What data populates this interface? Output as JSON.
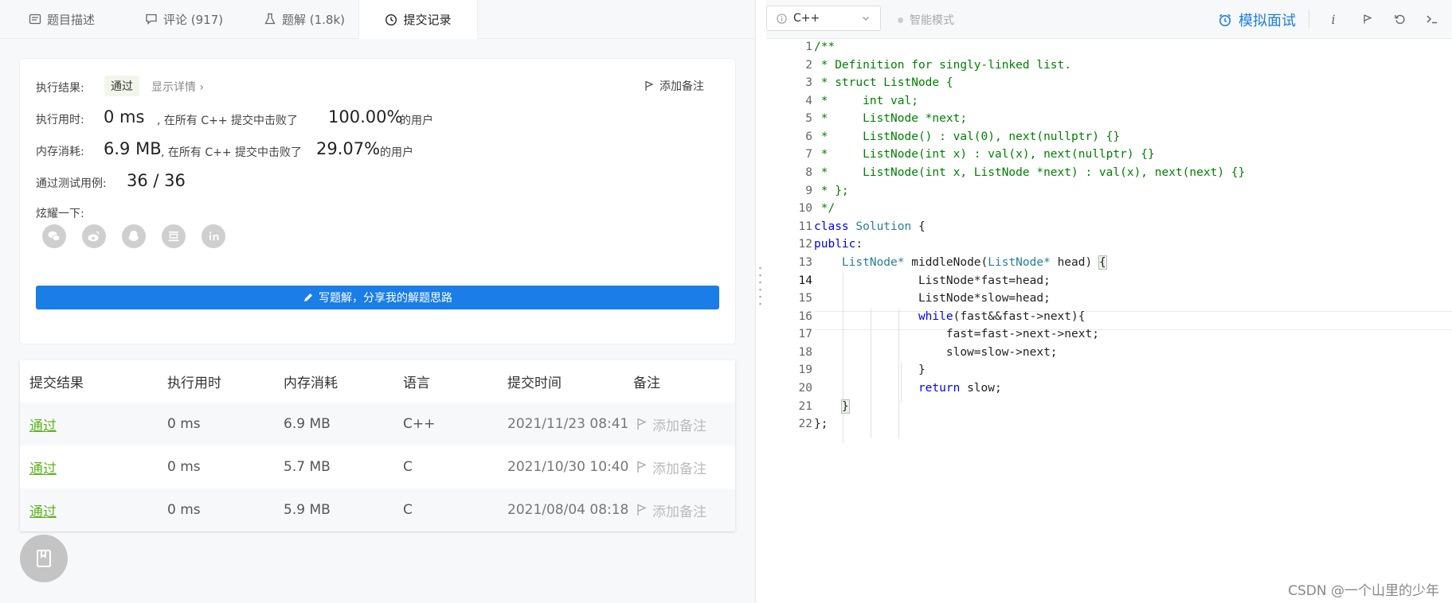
{
  "tabs": [
    {
      "label": "题目描述",
      "icon": "description-icon"
    },
    {
      "label": "评论 (917)",
      "icon": "comment-icon"
    },
    {
      "label": "题解 (1.8k)",
      "icon": "flask-icon"
    },
    {
      "label": "提交记录",
      "icon": "clock-icon",
      "active": true
    }
  ],
  "result": {
    "label": "执行结果:",
    "status": "通过",
    "detail_link": "显示详情 ›",
    "add_note": "添加备注",
    "time_label": "执行用时:",
    "time_value": "0 ms",
    "time_text": ", 在所有 C++ 提交中击败了",
    "time_percent": "100.00%",
    "time_users": "的用户",
    "mem_label": "内存消耗:",
    "mem_value": "6.9 MB",
    "mem_text": ", 在所有 C++ 提交中击败了",
    "mem_percent": "29.07%",
    "mem_users": "的用户",
    "cases_label": "通过测试用例:",
    "cases_value": "36 / 36",
    "share_label": "炫耀一下:",
    "share_icons": [
      "wechat-icon",
      "weibo-icon",
      "qq-icon",
      "douban-icon",
      "linkedin-icon"
    ],
    "write_button": "写题解，分享我的解题思路"
  },
  "table": {
    "headers": [
      "提交结果",
      "执行用时",
      "内存消耗",
      "语言",
      "提交时间",
      "备注"
    ],
    "rows": [
      {
        "result": "通过",
        "time": "0 ms",
        "memory": "6.9 MB",
        "lang": "C++",
        "date": "2021/11/23 08:41",
        "note": "添加备注"
      },
      {
        "result": "通过",
        "time": "0 ms",
        "memory": "5.7 MB",
        "lang": "C",
        "date": "2021/10/30 10:40",
        "note": "添加备注"
      },
      {
        "result": "通过",
        "time": "0 ms",
        "memory": "5.9 MB",
        "lang": "C",
        "date": "2021/08/04 08:18",
        "note": "添加备注"
      }
    ]
  },
  "editor": {
    "language": "C++",
    "smart_mode": "智能模式",
    "mock_interview": "模拟面试",
    "current_line": 14,
    "line_numbers": [
      "1",
      "2",
      "3",
      "4",
      "5",
      "6",
      "7",
      "8",
      "9",
      "10",
      "11",
      "12",
      "13",
      "14",
      "15",
      "16",
      "17",
      "18",
      "19",
      "20",
      "21",
      "22"
    ]
  },
  "watermark": "CSDN @一个山里的少年",
  "colors": {
    "accent": "#1a7de8",
    "pass": "#5cb31d"
  }
}
